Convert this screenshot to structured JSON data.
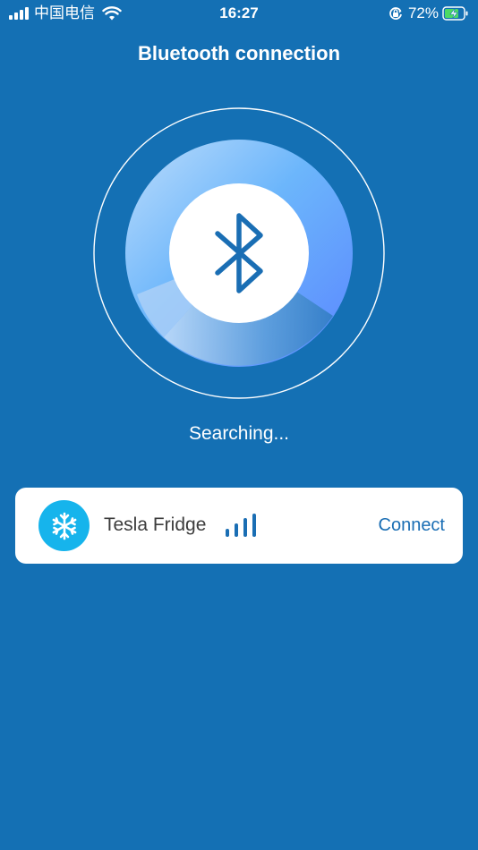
{
  "status_bar": {
    "carrier": "中国电信",
    "time": "16:27",
    "battery_percent": "72%",
    "signal_strength": 4,
    "wifi_icon": "wifi-icon",
    "orientation_lock_icon": "orientation-lock-icon",
    "battery_icon": "battery-charging-icon"
  },
  "header": {
    "title": "Bluetooth connection"
  },
  "scanner": {
    "icon": "bluetooth-icon",
    "status_text": "Searching..."
  },
  "devices": [
    {
      "name": "Tesla Fridge",
      "icon": "snowflake-icon",
      "signal_icon": "signal-strength-icon",
      "action_label": "Connect"
    }
  ],
  "colors": {
    "background": "#1470b4",
    "card": "#ffffff",
    "accent": "#1a6eb4",
    "device_icon_bg": "#16b4ec"
  }
}
